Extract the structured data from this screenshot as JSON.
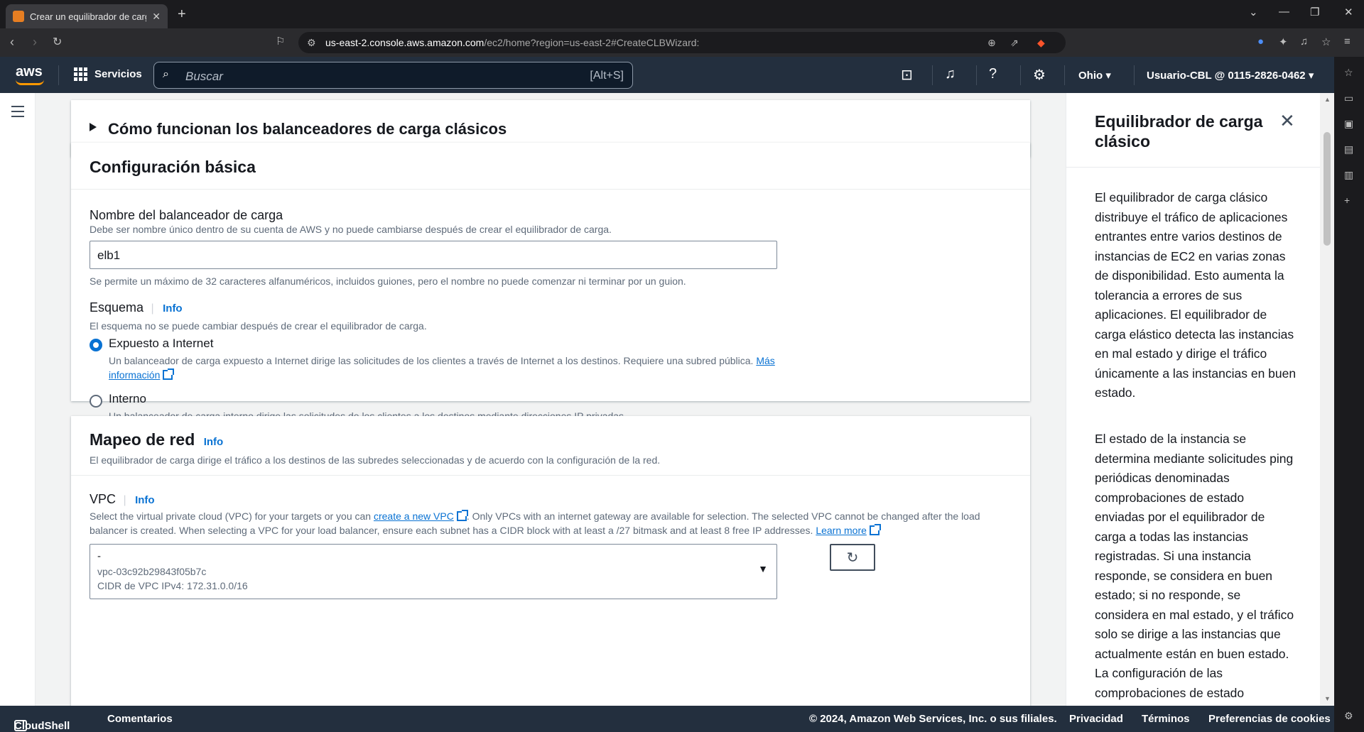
{
  "browser": {
    "tab_title": "Crear un equilibrador de carga",
    "url_host": "us-east-2.console.aws.amazon.com",
    "url_path": "/ec2/home?region=us-east-2#CreateCLBWizard:"
  },
  "aws_nav": {
    "logo": "aws",
    "services_label": "Servicios",
    "search_placeholder": "Buscar",
    "search_shortcut": "[Alt+S]",
    "region": "Ohio",
    "user": "Usuario-CBL @ 0115-2826-0462"
  },
  "expander": {
    "title": "Cómo funcionan los balanceadores de carga clásicos"
  },
  "basic_config": {
    "title": "Configuración básica",
    "name_label": "Nombre del balanceador de carga",
    "name_desc": "Debe ser nombre único dentro de su cuenta de AWS y no puede cambiarse después de crear el equilibrador de carga.",
    "name_value": "elb1",
    "name_hint": "Se permite un máximo de 32 caracteres alfanuméricos, incluidos guiones, pero el nombre no puede comenzar ni terminar por un guion.",
    "scheme_label": "Esquema",
    "scheme_info": "Info",
    "scheme_desc": "El esquema no se puede cambiar después de crear el equilibrador de carga.",
    "option_internet_label": "Expuesto a Internet",
    "option_internet_desc": "Un balanceador de carga expuesto a Internet dirige las solicitudes de los clientes a través de Internet a los destinos. Requiere una subred pública.",
    "option_internet_link": "Más información",
    "option_internal_label": "Interno",
    "option_internal_desc": "Un balanceador de carga interno dirige las solicitudes de los clientes a los destinos mediante direcciones IP privadas."
  },
  "network": {
    "title": "Mapeo de red",
    "info": "Info",
    "desc": "El equilibrador de carga dirige el tráfico a los destinos de las subredes seleccionadas y de acuerdo con la configuración de la red.",
    "vpc_label": "VPC",
    "vpc_info": "Info",
    "vpc_desc_1": "Select the virtual private cloud (VPC) for your targets or you can",
    "vpc_link_1": "create a new VPC",
    "vpc_desc_2": ". Only VPCs with an internet gateway are available for selection. The selected VPC cannot be changed after the load balancer is created. When selecting a VPC for your load balancer, ensure each subnet has a CIDR block with at least a /27 bitmask and at least 8 free IP addresses.",
    "vpc_link_2": "Learn more",
    "vpc_selected_name": "-",
    "vpc_selected_id": "vpc-03c92b29843f05b7c",
    "vpc_selected_cidr": "CIDR de VPC IPv4: 172.31.0.0/16"
  },
  "help_panel": {
    "title": "Equilibrador de carga clásico",
    "para1": "El equilibrador de carga clásico distribuye el tráfico de aplicaciones entrantes entre varios destinos de instancias de EC2 en varias zonas de disponibilidad. Esto aumenta la tolerancia a errores de sus aplicaciones. El equilibrador de carga elástico detecta las instancias en mal estado y dirige el tráfico únicamente a las instancias en buen estado.",
    "para2": "El estado de la instancia se determina mediante solicitudes ping periódicas denominadas comprobaciones de estado enviadas por el equilibrador de carga a todas las instancias registradas. Si una instancia responde, se considera en buen estado; si no responde, se considera en mal estado, y el tráfico solo se dirige a las instancias que actualmente están en buen estado. La configuración de las comprobaciones de estado"
  },
  "footer": {
    "cloudshell": "CloudShell",
    "comments": "Comentarios",
    "copyright": "© 2024, Amazon Web Services, Inc. o sus filiales.",
    "privacy": "Privacidad",
    "terms": "Términos",
    "cookies": "Preferencias de cookies"
  },
  "colors": {
    "aws_nav_bg": "#232f3e",
    "link": "#0972d3",
    "aws_orange": "#ff9900"
  }
}
